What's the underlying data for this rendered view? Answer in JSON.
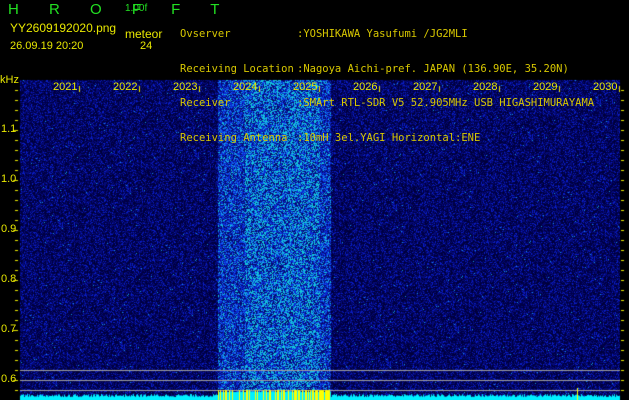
{
  "app": {
    "name": "H R O F F T",
    "version": "1.00f"
  },
  "file": {
    "name": "YY2609192020.png",
    "datetime": "26.09.19 20:20"
  },
  "detection": {
    "mode": "meteor",
    "count": "24"
  },
  "station": [
    {
      "label": "Ovserver",
      "value": ":YOSHIKAWA Yasufumi /JG2MLI"
    },
    {
      "label": "Receiving Location",
      "value": ":Nagoya Aichi-pref. JAPAN (136.90E, 35.20N)"
    },
    {
      "label": "Receiver",
      "value": ":SMArt RTL-SDR V5 52.905MHz USB HIGASHIMURAYAMA"
    },
    {
      "label": "Receiving Antenna",
      "value": ":10mH 3el.YAGI Horizontal:ENE"
    }
  ],
  "spectrogram": {
    "y_unit": "kHz",
    "y_ticks": [
      "1.1",
      "1.0",
      "0.9",
      "0.8",
      "0.7",
      "0.6"
    ],
    "x_ticks": [
      "2021",
      "2022",
      "2023",
      "2024",
      "2025",
      "2026",
      "2027",
      "2028",
      "2029",
      "2030"
    ],
    "colors": {
      "background": "#000000",
      "noise": "#1020c0",
      "peak": "#00e0ff",
      "labels": "#e8e800",
      "title": "#22e022"
    }
  }
}
